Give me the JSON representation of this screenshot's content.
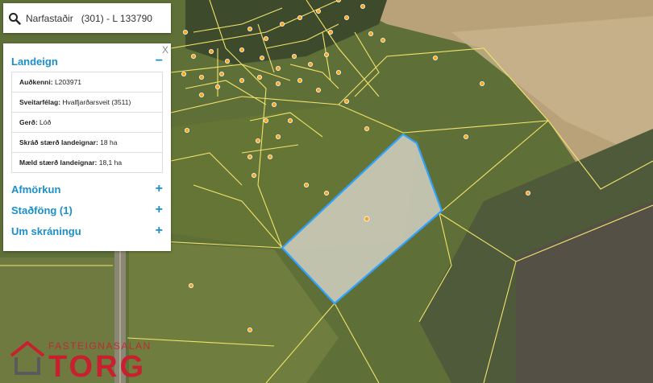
{
  "search": {
    "query": "Narfastaðir   (301) - L 133790",
    "icon": "search-icon"
  },
  "panel": {
    "close_label": "X",
    "landeign": {
      "title": "Landeign",
      "toggle": "−",
      "rows": [
        {
          "label": "Auðkenni:",
          "value": "L203971"
        },
        {
          "label": "Sveitarfélag:",
          "value": "Hvalfjarðarsveit (3511)"
        },
        {
          "label": "Gerð:",
          "value": "Lóð"
        },
        {
          "label": "Skráð stærð landeignar:",
          "value": "18 ha"
        },
        {
          "label": "Mæld stærð landeignar:",
          "value": "18,1 ha"
        }
      ]
    },
    "sections": [
      {
        "title": "Afmörkun",
        "toggle": "+"
      },
      {
        "title": "Staðföng (1)",
        "toggle": "+"
      },
      {
        "title": "Um skráningu",
        "toggle": "+"
      }
    ]
  },
  "logo": {
    "top_text": "FASTEIGNASALAN",
    "brand": "TORG"
  },
  "colors": {
    "accent": "#1a8fc9",
    "parcel_line": "#f2e36b",
    "selected_outline": "#2fa3ff",
    "address_dot": "#f5a623",
    "brand_red": "#c8202f"
  }
}
